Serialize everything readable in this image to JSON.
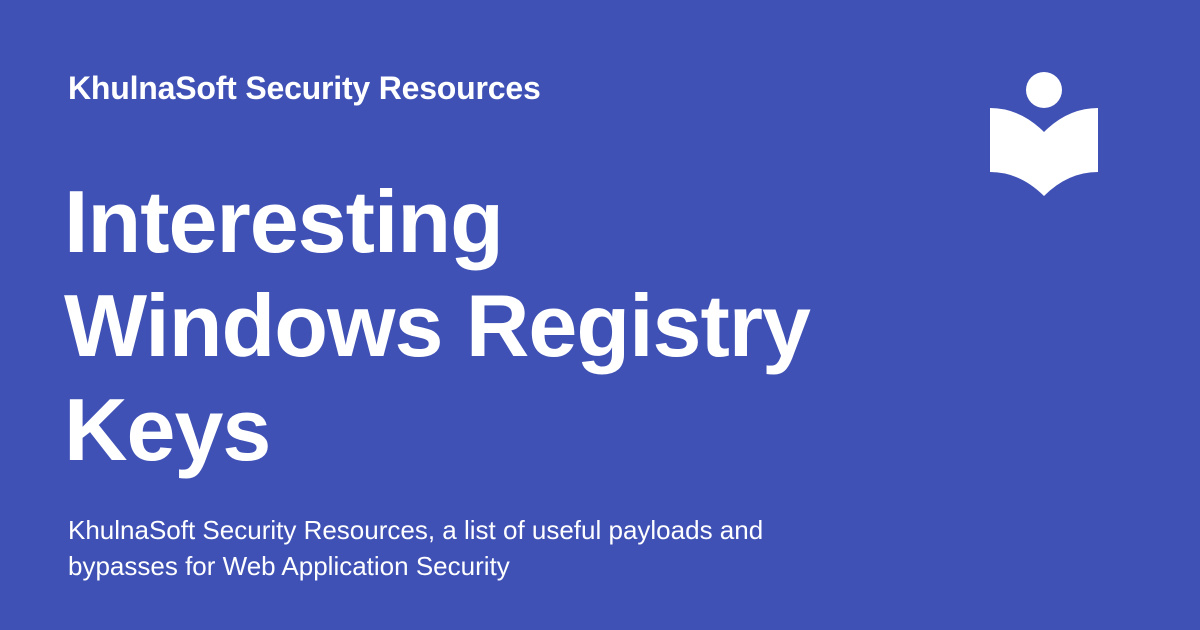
{
  "header": {
    "site_name": "KhulnaSoft Security Resources"
  },
  "main": {
    "title": "Interesting Windows Registry Keys",
    "description": "KhulnaSoft Security Resources, a list of useful payloads and bypasses for Web Application Security"
  },
  "logo": {
    "icon": "book-reader-icon"
  },
  "colors": {
    "background": "#3f51b5",
    "foreground": "#ffffff"
  }
}
